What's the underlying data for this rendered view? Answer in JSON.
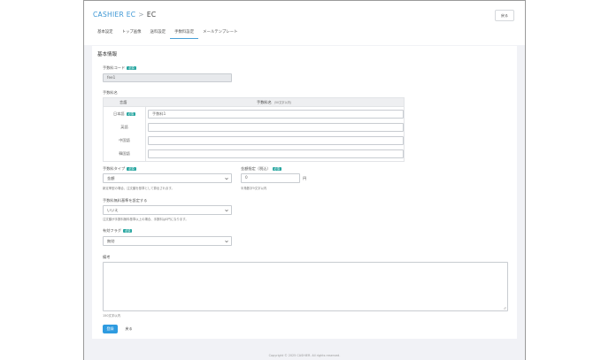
{
  "header": {
    "brand": "CASHIER EC",
    "separator": ">",
    "section": "EC",
    "back_label": "戻る"
  },
  "tabs": [
    {
      "label": "基本設定",
      "active": false
    },
    {
      "label": "トップ画像",
      "active": false
    },
    {
      "label": "送料設定",
      "active": false
    },
    {
      "label": "手数料設定",
      "active": true
    },
    {
      "label": "メールテンプレート",
      "active": false
    }
  ],
  "form": {
    "title": "基本情報",
    "fee_code": {
      "label": "手数料コード",
      "badge": "必須",
      "value": "fee1"
    },
    "fee_name": {
      "label": "手数料名",
      "col_language": "言語",
      "col_name": "手数料名",
      "col_name_hint": "(50文字以内)",
      "rows": [
        {
          "lang": "日本語",
          "badge": "必須",
          "value": "手数料1"
        },
        {
          "lang": "英語",
          "value": ""
        },
        {
          "lang": "中国語",
          "value": ""
        },
        {
          "lang": "韓国語",
          "value": ""
        }
      ]
    },
    "fee_type": {
      "label": "手数料タイプ",
      "badge": "必須",
      "value": "金額",
      "help": "新定率型の場合、注文額を基準として算出されます。"
    },
    "amount": {
      "label": "金額指定（税込）",
      "badge": "必須",
      "value": "0",
      "unit": "円",
      "help": "半角数字9文字以内"
    },
    "threshold": {
      "label": "手数料無料基準を設定する",
      "value": "いいえ",
      "help": "注文額が手数料無料基準以上の場合、手数料は0円になります。"
    },
    "active_flag": {
      "label": "有効フラグ",
      "badge": "必須",
      "value": "無効"
    },
    "note": {
      "label": "備考",
      "value": "",
      "help": "150文字以内"
    },
    "submit_label": "登録",
    "back_label": "戻る"
  },
  "footer": {
    "copyright": "Copyright © 2025 CASHIER. All rights reserved."
  }
}
